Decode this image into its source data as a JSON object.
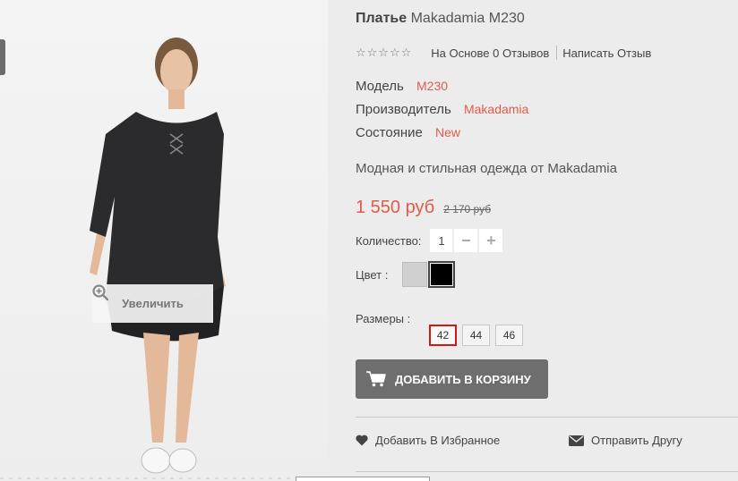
{
  "gallery": {
    "zoom_label": "Увеличить"
  },
  "product": {
    "title_word": "Платье",
    "title_rest": "Makadamia M230",
    "stars": "☆☆☆☆☆",
    "reviews_label": "На Основе 0 Отзывов",
    "write_review_label": "Написать Отзыв",
    "specs": [
      {
        "label": "Модель",
        "value": "M230"
      },
      {
        "label": "Производитель",
        "value": "Makadamia"
      },
      {
        "label": "Состояние",
        "value": "New"
      }
    ],
    "description": "Модная и стильная одежда от Makadamia",
    "price": "1 550 руб",
    "old_price": "2 170 руб",
    "quantity_label": "Количество:",
    "quantity_value": "1",
    "minus": "−",
    "plus": "+",
    "color_label": "Цвет :",
    "colors": [
      "#d0d0d0",
      "#000000"
    ],
    "sizes_label": "Размеры :",
    "sizes": [
      "42",
      "44",
      "46"
    ],
    "selected_size": "42",
    "add_to_cart": "ДОБАВИТЬ В КОРЗИНУ",
    "wishlist": "Добавить В Избранное",
    "send_friend": "Отправить Другу"
  },
  "colors": {
    "accent": "#e25a4a",
    "button": "#6e6e6e",
    "selected_size_border": "#d01818",
    "background": "#ececec"
  }
}
